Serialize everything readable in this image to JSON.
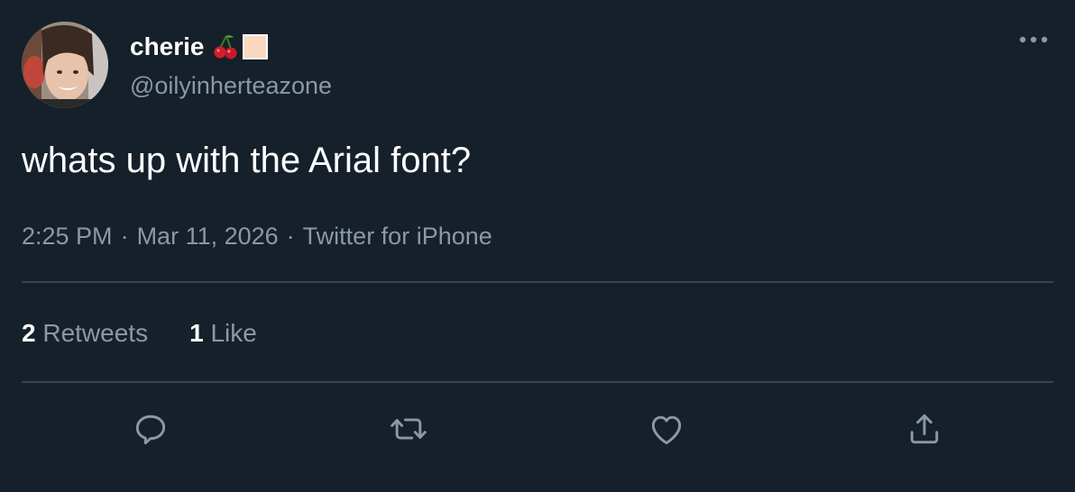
{
  "colors": {
    "background": "#15202b",
    "primary_text": "#ffffff",
    "secondary_text": "#8b98a5",
    "divider": "#38444d"
  },
  "author": {
    "display_name": "cherie",
    "name_emojis": [
      "cherries-emoji",
      "peach-square-emoji"
    ],
    "handle": "@oilyinherteazone",
    "avatar": "profile-photo"
  },
  "tweet": {
    "text": "whats up with the Arial font?",
    "time": "2:25 PM",
    "date": "Mar 11, 2026",
    "source": "Twitter for iPhone",
    "separator": "·"
  },
  "stats": {
    "retweets_count": "2",
    "retweets_label": "Retweets",
    "likes_count": "1",
    "likes_label": "Like"
  },
  "actions": [
    "reply-icon",
    "retweet-icon",
    "like-icon",
    "share-icon"
  ],
  "menu": {
    "icon": "more-dots-icon"
  }
}
